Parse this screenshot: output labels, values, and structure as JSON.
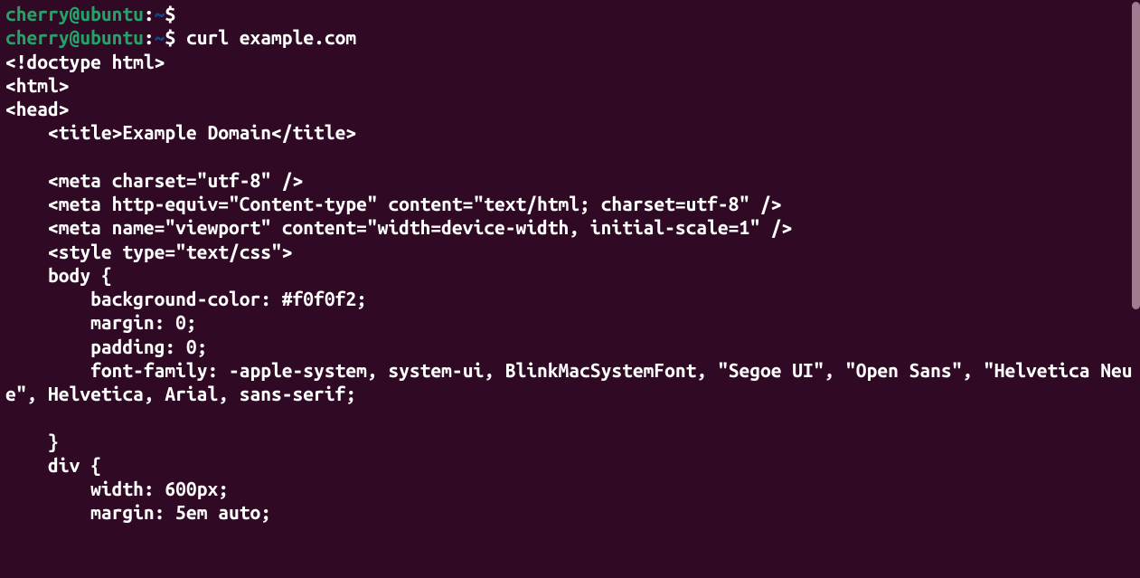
{
  "prompt1": {
    "user": "cherry@ubuntu",
    "colon": ":",
    "path": "~",
    "dollar": "$",
    "command": ""
  },
  "prompt2": {
    "user": "cherry@ubuntu",
    "colon": ":",
    "path": "~",
    "dollar": "$",
    "command": "curl example.com"
  },
  "output": "<!doctype html>\n<html>\n<head>\n    <title>Example Domain</title>\n\n    <meta charset=\"utf-8\" />\n    <meta http-equiv=\"Content-type\" content=\"text/html; charset=utf-8\" />\n    <meta name=\"viewport\" content=\"width=device-width, initial-scale=1\" />\n    <style type=\"text/css\">\n    body {\n        background-color: #f0f0f2;\n        margin: 0;\n        padding: 0;\n        font-family: -apple-system, system-ui, BlinkMacSystemFont, \"Segoe UI\", \"Open Sans\", \"Helvetica Neue\", Helvetica, Arial, sans-serif;\n\n    }\n    div {\n        width: 600px;\n        margin: 5em auto;"
}
